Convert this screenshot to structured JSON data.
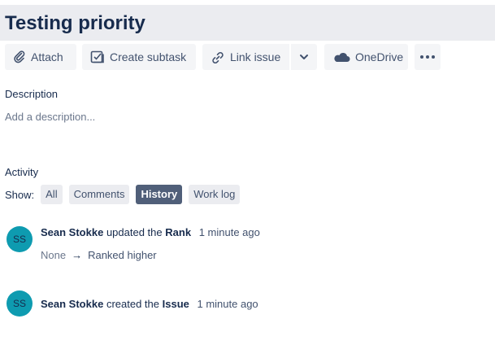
{
  "issue": {
    "title": "Testing priority"
  },
  "toolbar": {
    "attach": {
      "label": "Attach",
      "icon": "paperclip-icon"
    },
    "create_subtask": {
      "label": "Create subtask",
      "icon": "subtask-icon"
    },
    "link_issue": {
      "label": "Link issue",
      "icon": "link-icon"
    },
    "link_dropdown": {
      "icon": "chevron-down-icon"
    },
    "onedrive": {
      "label": "OneDrive",
      "icon": "cloud-icon"
    },
    "more": {
      "label": "•••",
      "icon": "more-icon"
    }
  },
  "description": {
    "heading": "Description",
    "placeholder": "Add a description..."
  },
  "activity": {
    "heading": "Activity",
    "show_label": "Show:",
    "tabs": [
      {
        "label": "All",
        "active": false
      },
      {
        "label": "Comments",
        "active": false
      },
      {
        "label": "History",
        "active": true
      },
      {
        "label": "Work log",
        "active": false
      }
    ],
    "entries": [
      {
        "initials": "SS",
        "user": "Sean Stokke",
        "action": "updated the",
        "field": "Rank",
        "time": "1 minute ago",
        "change": {
          "from": "None",
          "arrow": "→",
          "to": "Ranked higher"
        }
      },
      {
        "initials": "SS",
        "user": "Sean Stokke",
        "action": "created the",
        "field": "Issue",
        "time": "1 minute ago"
      }
    ]
  },
  "colors": {
    "avatar": "#0e9bb0",
    "active_tab": "#505f79",
    "title_bar": "#ebecf0"
  }
}
